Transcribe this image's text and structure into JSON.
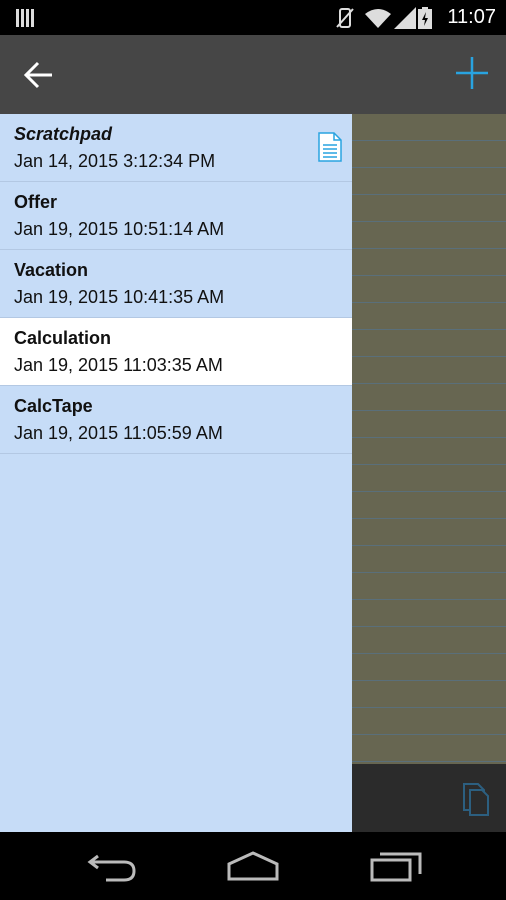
{
  "status_bar": {
    "time": "11:07"
  },
  "colors": {
    "accent": "#29a3e0",
    "list_bg": "#c6dcf7",
    "app_bar": "#464646",
    "notepad": "#676651"
  },
  "notes": [
    {
      "title": "Scratchpad",
      "date": "Jan 14, 2015 3:12:34 PM"
    },
    {
      "title": "Offer",
      "date": "Jan 19, 2015 10:51:14 AM"
    },
    {
      "title": "Vacation",
      "date": "Jan 19, 2015 10:41:35 AM"
    },
    {
      "title": "Calculation",
      "date": "Jan 19, 2015 11:03:35 AM"
    },
    {
      "title": "CalcTape",
      "date": "Jan 19, 2015 11:05:59 AM"
    }
  ]
}
